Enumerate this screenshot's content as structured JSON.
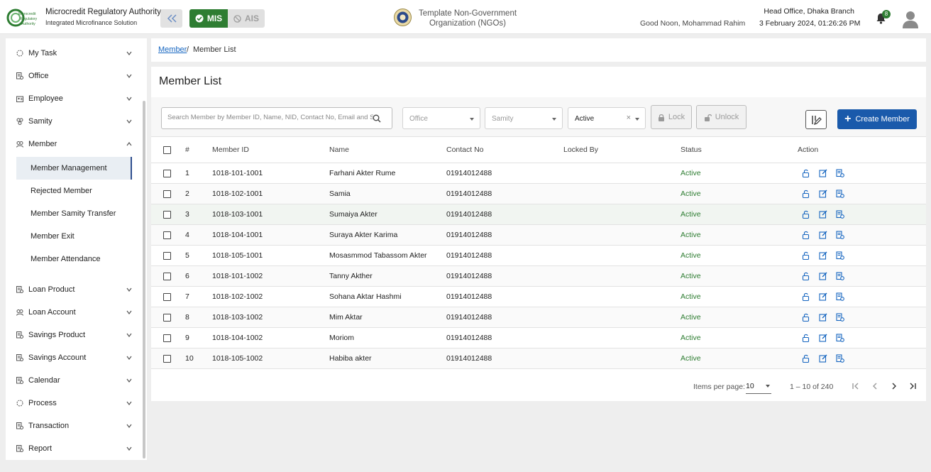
{
  "header": {
    "brand_title": "Microcredit Regulatory Authority",
    "brand_subtitle": "Integrated Microfinance Solution",
    "logo_text": "Microcredit Regulatory Authority",
    "mis_label": "MIS",
    "ais_label": "AIS",
    "org_name": "Template Non-Government Organization (NGOs)",
    "greeting": "Good Noon, Mohammad Rahim",
    "branch": "Head Office, Dhaka Branch",
    "datetime": "3 February 2024, 01:26:26 PM",
    "notification_count": "8",
    "accent": "#2e7d32"
  },
  "sidebar": {
    "items": [
      {
        "label": "My Task",
        "icon": "task-icon"
      },
      {
        "label": "Office",
        "icon": "office-icon"
      },
      {
        "label": "Employee",
        "icon": "employee-icon"
      },
      {
        "label": "Samity",
        "icon": "samity-icon"
      },
      {
        "label": "Member",
        "icon": "member-icon",
        "expanded": true
      },
      {
        "label": "Loan Product",
        "icon": "loan-product-icon"
      },
      {
        "label": "Loan Account",
        "icon": "loan-account-icon"
      },
      {
        "label": "Savings Product",
        "icon": "savings-product-icon"
      },
      {
        "label": "Savings Account",
        "icon": "savings-account-icon"
      },
      {
        "label": "Calendar",
        "icon": "calendar-icon"
      },
      {
        "label": "Process",
        "icon": "process-icon"
      },
      {
        "label": "Transaction",
        "icon": "transaction-icon"
      },
      {
        "label": "Report",
        "icon": "report-icon"
      }
    ],
    "member_subitems": [
      {
        "label": "Member Management",
        "active": true
      },
      {
        "label": "Rejected Member"
      },
      {
        "label": "Member Samity Transfer"
      },
      {
        "label": "Member Exit"
      },
      {
        "label": "Member Attendance"
      }
    ]
  },
  "breadcrumb": {
    "link": "Member",
    "separator": "/",
    "current": "Member List"
  },
  "page": {
    "title": "Member List"
  },
  "filters": {
    "search_placeholder": "Search Member by Member ID, Name, NID, Contact No, Email and Status",
    "office_placeholder": "Office",
    "samity_placeholder": "Samity",
    "status_value": "Active",
    "clear_symbol": "×",
    "lock_label": "Lock",
    "unlock_label": "Unlock",
    "create_label": "Create Member"
  },
  "table": {
    "columns": [
      "#",
      "Member ID",
      "Name",
      "Contact No",
      "Locked By",
      "Status",
      "Action"
    ],
    "rows": [
      {
        "no": "1",
        "member_id": "1018-101-1001",
        "name": "Farhani Akter Rume",
        "contact": "01914012488",
        "locked_by": "",
        "status": "Active"
      },
      {
        "no": "2",
        "member_id": "1018-102-1001",
        "name": "Samia",
        "contact": "01914012488",
        "locked_by": "",
        "status": "Active"
      },
      {
        "no": "3",
        "member_id": "1018-103-1001",
        "name": "Sumaiya Akter",
        "contact": "01914012488",
        "locked_by": "",
        "status": "Active"
      },
      {
        "no": "4",
        "member_id": "1018-104-1001",
        "name": "Suraya Akter Karima",
        "contact": "01914012488",
        "locked_by": "",
        "status": "Active"
      },
      {
        "no": "5",
        "member_id": "1018-105-1001",
        "name": "Mosasmmod Tabassom Akter",
        "contact": "01914012488",
        "locked_by": "",
        "status": "Active"
      },
      {
        "no": "6",
        "member_id": "1018-101-1002",
        "name": "Tanny Akther",
        "contact": "01914012488",
        "locked_by": "",
        "status": "Active"
      },
      {
        "no": "7",
        "member_id": "1018-102-1002",
        "name": "Sohana Aktar Hashmi",
        "contact": "01914012488",
        "locked_by": "",
        "status": "Active"
      },
      {
        "no": "8",
        "member_id": "1018-103-1002",
        "name": "Mim Aktar",
        "contact": "01914012488",
        "locked_by": "",
        "status": "Active"
      },
      {
        "no": "9",
        "member_id": "1018-104-1002",
        "name": "Moriom",
        "contact": "01914012488",
        "locked_by": "",
        "status": "Active"
      },
      {
        "no": "10",
        "member_id": "1018-105-1002",
        "name": "Habiba akter",
        "contact": "01914012488",
        "locked_by": "",
        "status": "Active"
      }
    ],
    "row_actions": [
      "unlock-icon",
      "edit-icon",
      "details-icon"
    ],
    "status_color": "#2e7d32"
  },
  "paginator": {
    "items_per_page_label": "Items per page:",
    "page_size": "10",
    "range_label": "1 – 10 of 240"
  }
}
